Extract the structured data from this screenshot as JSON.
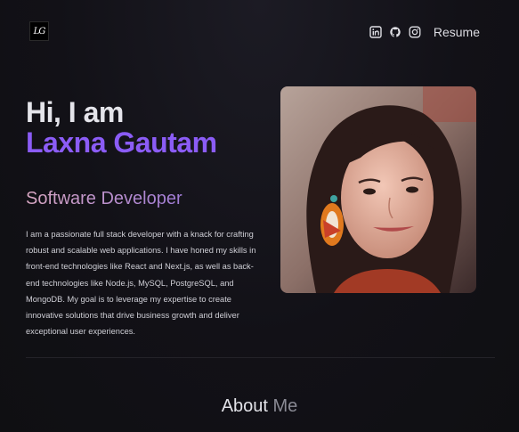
{
  "header": {
    "logo_text": "LG",
    "nav_icons": [
      "linkedin-icon",
      "github-icon",
      "instagram-icon"
    ],
    "resume_label": "Resume"
  },
  "hero": {
    "greeting": "Hi, I am",
    "name": "Laxna Gautam",
    "role": "Software Developer",
    "bio": "I am a passionate full stack developer with a knack for crafting robust and scalable web applications. I have honed my skills in front-end technologies like React and Next.js, as well as back-end technologies like Node.js, MySQL, PostgreSQL, and MongoDB. My goal is to leverage my expertise to create innovative solutions that drive business growth and deliver exceptional user experiences."
  },
  "about": {
    "title_word1": "About",
    "title_word2": "Me"
  },
  "colors": {
    "accent": "#8b5cf6",
    "background": "#121117"
  }
}
